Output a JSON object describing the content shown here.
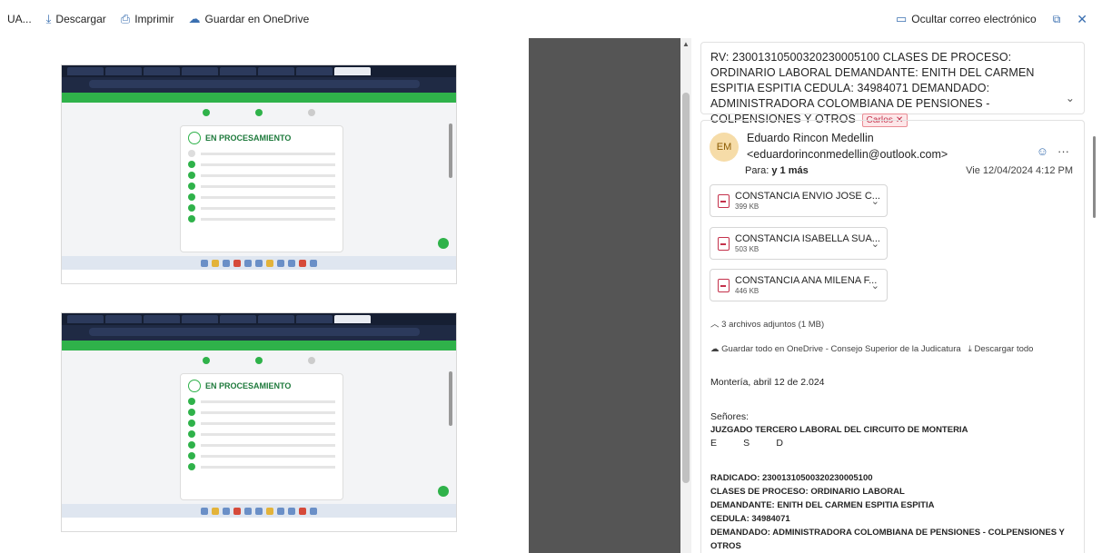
{
  "toolbar": {
    "back_label": "UA...",
    "download_label": "Descargar",
    "print_label": "Imprimir",
    "onedrive_label": "Guardar en OneDrive",
    "hide_email_label": "Ocultar correo electrónico"
  },
  "preview": {
    "shot1_title": "EN PROCESAMIENTO",
    "shot2_title": "EN PROCESAMIENTO"
  },
  "email": {
    "subject": "RV:  23001310500320230005100  CLASES DE PROCESO: ORDINARIO LABORAL  DEMANDANTE: ENITH DEL CARMEN ESPITIA ESPITIA  CEDULA: 34984071  DEMANDADO: ADMINISTRADORA COLOMBIANA DE PENSIONES - COLPENSIONES Y OTROS",
    "tag": "Carlos",
    "avatar_initials": "EM",
    "sender_name": "Eduardo Rincon Medellin",
    "sender_email": "<eduardorinconmedellin@outlook.com>",
    "to_prefix": "Para:",
    "to_value": "y 1 más",
    "date": "Vie 12/04/2024 4:12 PM",
    "attachments": [
      {
        "name": "CONSTANCIA ENVIO JOSE C...",
        "size": "399 KB"
      },
      {
        "name": "CONSTANCIA ISABELLA SUA...",
        "size": "503 KB"
      },
      {
        "name": "CONSTANCIA ANA MILENA F...",
        "size": "446 KB"
      }
    ],
    "attachments_summary": "3 archivos adjuntos (1 MB)",
    "save_all_label": "Guardar todo en OneDrive - Consejo Superior de la Judicatura",
    "download_all_label": "Descargar todo",
    "body": {
      "date_line": "Montería, abril  12  de 2.024",
      "greeting": "Señores:",
      "court": "JUZGADO TERCERO LABORAL DEL CIRCUITO DE MONTERIA",
      "esd": "E          S          D",
      "radicado": "RADICADO: 23001310500320230005100",
      "clase": "CLASES DE PROCESO: ORDINARIO LABORAL",
      "demandante": "DEMANDANTE: ENITH DEL CARMEN ESPITIA ESPITIA",
      "cedula": "CEDULA: 34984071",
      "demandado": "DEMANDADO: ADMINISTRADORA COLOMBIANA DE PENSIONES - COLPENSIONES Y OTROS"
    }
  }
}
